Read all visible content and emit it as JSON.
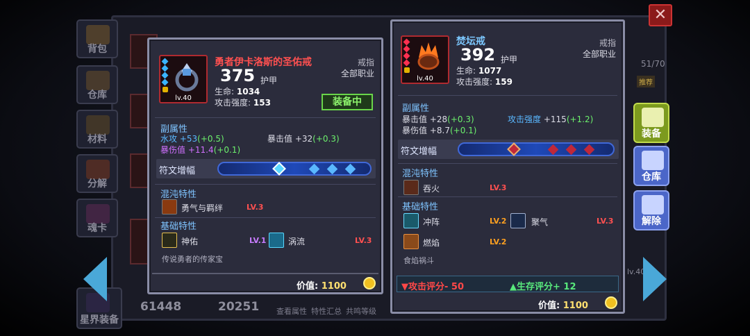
{
  "background": {
    "menu": [
      "背包",
      "仓库",
      "材料",
      "分解",
      "魂卡",
      "星界装备"
    ],
    "counter": "51/70",
    "tag": "推荐",
    "bottom_value_1": "61448",
    "bottom_value_2": "20251",
    "bottom_buttons": [
      "查看属性",
      "特性汇总",
      "共鸣等级"
    ],
    "side_level": "lv.40"
  },
  "right_actions": {
    "equip": "装备",
    "store": "仓库",
    "remove": "解除"
  },
  "left_item": {
    "name": "勇者伊卡洛斯的圣佑戒",
    "name_color": "#ff5050",
    "level": "lv.40",
    "score": "375",
    "score_type": "护甲",
    "hp_label": "生命:",
    "hp": "1034",
    "atk_label": "攻击强度:",
    "atk": "153",
    "slot": "戒指",
    "job": "全部职业",
    "equipped_label": "装备中",
    "sub_title": "副属性",
    "subs": [
      {
        "label": "水攻",
        "base": "+53",
        "bonus": "(+0.5)",
        "color": "#5ab8ff"
      },
      {
        "label": "暴击值",
        "base": "+32",
        "bonus": "(+0.3)",
        "color": "#ffffff"
      },
      {
        "label": "暴伤值",
        "base": "+11.4",
        "bonus": "(+0.1)",
        "color": "#d070ff"
      }
    ],
    "rune_label": "符文增幅",
    "chaos_title": "混沌特性",
    "chaos_traits": [
      {
        "name": "勇气与羁绊",
        "level": "LV.3"
      }
    ],
    "basic_title": "基础特性",
    "basic_traits": [
      {
        "name": "神佑",
        "level": "LV.1"
      },
      {
        "name": "涡流",
        "level": "LV.3"
      }
    ],
    "description": "传说勇者的传家宝",
    "price_label": "价值:",
    "price": "1100"
  },
  "right_item": {
    "name": "焚坛戒",
    "name_color": "#7cc8ff",
    "level": "lv.40",
    "score": "392",
    "score_type": "护甲",
    "hp_label": "生命:",
    "hp": "1077",
    "atk_label": "攻击强度:",
    "atk": "159",
    "slot": "戒指",
    "job": "全部职业",
    "sub_title": "副属性",
    "subs": [
      {
        "label": "暴击值",
        "base": "+28",
        "bonus": "(+0.3)",
        "color": "#ffffff"
      },
      {
        "label": "攻击强度",
        "base": "+115",
        "bonus": "(+1.2)",
        "color": "#5ab8ff"
      },
      {
        "label": "暴伤值",
        "base": "+8.7",
        "bonus": "(+0.1)",
        "color": "#ffffff"
      }
    ],
    "rune_label": "符文增幅",
    "chaos_title": "混沌特性",
    "chaos_traits": [
      {
        "name": "吞火",
        "level": "LV.3"
      }
    ],
    "basic_title": "基础特性",
    "basic_traits": [
      {
        "name": "冲阵",
        "level": "LV.2"
      },
      {
        "name": "聚气",
        "level": "LV.3"
      },
      {
        "name": "燃焰",
        "level": "LV.2"
      }
    ],
    "description": "食焰祸斗",
    "score_down": "▼攻击评分- 50",
    "score_up": "▲生存评分+ 12",
    "price_label": "价值:",
    "price": "1100"
  }
}
